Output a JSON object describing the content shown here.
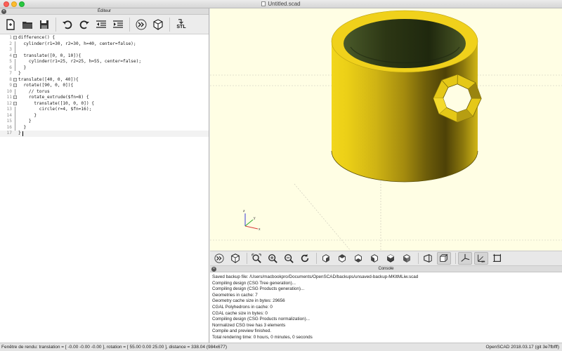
{
  "window": {
    "title": "Untitled.scad"
  },
  "editor": {
    "title": "Éditeur",
    "toolbar": {
      "new": "new-file",
      "open": "open-file",
      "save": "save",
      "undo": "undo",
      "redo": "redo",
      "unindent": "unindent",
      "indent": "indent",
      "preview": "preview",
      "render": "render",
      "export_label": "STL"
    },
    "lines": [
      {
        "n": "1",
        "text": "difference() {"
      },
      {
        "n": "2",
        "text": "  cylinder(r1=30, r2=30, h=40, center=false);"
      },
      {
        "n": "3",
        "text": ""
      },
      {
        "n": "4",
        "text": "  translate([0, 0, 10]){"
      },
      {
        "n": "5",
        "text": "    cylinder(r1=25, r2=25, h=55, center=false);"
      },
      {
        "n": "6",
        "text": "  }"
      },
      {
        "n": "7",
        "text": "}"
      },
      {
        "n": "8",
        "text": "translate([40, 0, 40]){"
      },
      {
        "n": "9",
        "text": "  rotate([90, 0, 0]){"
      },
      {
        "n": "10",
        "text": "    // torus"
      },
      {
        "n": "11",
        "text": "    rotate_extrude($fn=8) {"
      },
      {
        "n": "12",
        "text": "      translate([10, 0, 0]) {"
      },
      {
        "n": "13",
        "text": "        circle(r=4, $fn=16);"
      },
      {
        "n": "14",
        "text": "      }"
      },
      {
        "n": "15",
        "text": "    }"
      },
      {
        "n": "16",
        "text": "  }"
      },
      {
        "n": "17",
        "text": "}"
      }
    ]
  },
  "viewport": {
    "background": "#fffee4",
    "model_color": "#f0d31a",
    "axes": {
      "x": "x",
      "y": "y",
      "z": "z"
    }
  },
  "view_toolbar": [
    "preview",
    "render",
    "view-all",
    "zoom-in",
    "zoom-out",
    "reset-view",
    "view-right",
    "view-top",
    "view-bottom",
    "view-left",
    "view-front",
    "view-back",
    "perspective",
    "orthogonal",
    "show-axes",
    "show-scale-markers",
    "show-edges"
  ],
  "console": {
    "title": "Console",
    "lines": [
      "Saved backup file: /Users/macbookpro/Documents/OpenSCAD/backups/unsaved-backup-MKltMLiw.scad",
      "Compiling design (CSG Tree generation)...",
      "Compiling design (CSG Products generation)...",
      "Geometries in cache: 7",
      "Geometry cache size in bytes: 29656",
      "CGAL Polyhedrons in cache: 0",
      "CGAL cache size in bytes: 0",
      "Compiling design (CSG Products normalization)...",
      "Normalized CSG tree has 3 elements",
      "Compile and preview finished.",
      "Total rendering time: 0 hours, 0 minutes, 0 seconds"
    ]
  },
  "status": {
    "left": "Fenêtre de rendu: translation = [ -0.00 -0.00 -0.00 ], rotation = [ 55.00 0.00 25.00 ], distance = 338.04 (984x677)",
    "right": "OpenSCAD 2018.03.17 (git 3e7fbfff)"
  }
}
